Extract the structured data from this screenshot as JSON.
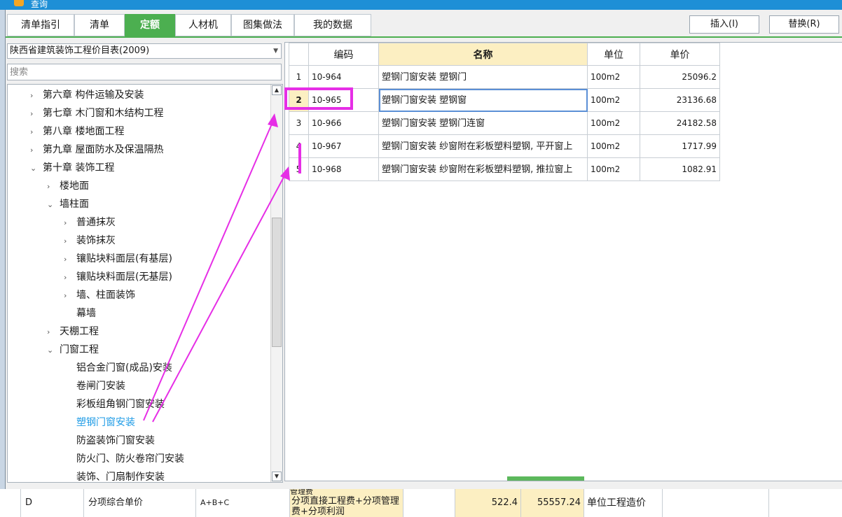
{
  "window": {
    "title": "查询"
  },
  "tabs": [
    {
      "label": "清单指引",
      "active": false
    },
    {
      "label": "清单",
      "active": false
    },
    {
      "label": "定额",
      "active": true
    },
    {
      "label": "人材机",
      "active": false
    },
    {
      "label": "图集做法",
      "active": false
    },
    {
      "label": "我的数据",
      "active": false
    }
  ],
  "actions": {
    "insert_label": "插入(I)",
    "replace_label": "替换(R)"
  },
  "library_select": {
    "value": "陕西省建筑装饰工程价目表(2009)"
  },
  "search": {
    "placeholder": "搜索",
    "value": ""
  },
  "tree": [
    {
      "label": "第六章 构件运输及安装",
      "chev": "›",
      "level": 0
    },
    {
      "label": "第七章 木门窗和木结构工程",
      "chev": "›",
      "level": 0
    },
    {
      "label": "第八章 楼地面工程",
      "chev": "›",
      "level": 0
    },
    {
      "label": "第九章 屋面防水及保温隔热",
      "chev": "›",
      "level": 0
    },
    {
      "label": "第十章 装饰工程",
      "chev": "⌄",
      "level": 0
    },
    {
      "label": "楼地面",
      "chev": "›",
      "level": 1
    },
    {
      "label": "墙柱面",
      "chev": "⌄",
      "level": 1
    },
    {
      "label": "普通抹灰",
      "chev": "›",
      "level": 2
    },
    {
      "label": "装饰抹灰",
      "chev": "›",
      "level": 2
    },
    {
      "label": "镶贴块料面层(有基层)",
      "chev": "›",
      "level": 2
    },
    {
      "label": "镶贴块料面层(无基层)",
      "chev": "›",
      "level": 2
    },
    {
      "label": "墙、柱面装饰",
      "chev": "›",
      "level": 2
    },
    {
      "label": "幕墙",
      "chev": "",
      "level": 2
    },
    {
      "label": "天棚工程",
      "chev": "›",
      "level": 1
    },
    {
      "label": "门窗工程",
      "chev": "⌄",
      "level": 1
    },
    {
      "label": "铝合金门窗(成品)安装",
      "chev": "",
      "level": 2
    },
    {
      "label": "卷闸门安装",
      "chev": "",
      "level": 2
    },
    {
      "label": "彩板组角钢门窗安装",
      "chev": "",
      "level": 2
    },
    {
      "label": "塑钢门窗安装",
      "chev": "",
      "level": 2,
      "selected": true
    },
    {
      "label": "防盗装饰门窗安装",
      "chev": "",
      "level": 2
    },
    {
      "label": "防火门、防火卷帘门安装",
      "chev": "",
      "level": 2
    },
    {
      "label": "装饰、门扇制作安装",
      "chev": "",
      "level": 2
    }
  ],
  "grid": {
    "headers": {
      "num": "",
      "code": "编码",
      "name": "名称",
      "unit": "单位",
      "price": "单价"
    },
    "rows": [
      {
        "num": "1",
        "code": "10-964",
        "name": "塑钢门窗安装 塑钢门",
        "unit": "100m2",
        "price": "25096.2"
      },
      {
        "num": "2",
        "code": "10-965",
        "name": "塑钢门窗安装 塑钢窗",
        "unit": "100m2",
        "price": "23136.68"
      },
      {
        "num": "3",
        "code": "10-966",
        "name": "塑钢门窗安装 塑钢门连窗",
        "unit": "100m2",
        "price": "24182.58"
      },
      {
        "num": "4",
        "code": "10-967",
        "name": "塑钢门窗安装 纱窗附在彩板塑料塑钢, 平开窗上",
        "unit": "100m2",
        "price": "1717.99"
      },
      {
        "num": "5",
        "code": "10-968",
        "name": "塑钢门窗安装 纱窗附在彩板塑料塑钢, 推拉窗上",
        "unit": "100m2",
        "price": "1082.91"
      }
    ]
  },
  "bottom_row": {
    "top_text": "管理费",
    "code": "D",
    "name": "分项综合单价",
    "formula": "A+B+C",
    "desc": "分项直接工程费+分项管理费+分项利润",
    "v1": "522.4",
    "v2": "55557.24",
    "label": "单位工程造价"
  },
  "colors": {
    "accent": "#4caf50",
    "highlight": "#e62ee6",
    "selected_text": "#1e9be6"
  }
}
